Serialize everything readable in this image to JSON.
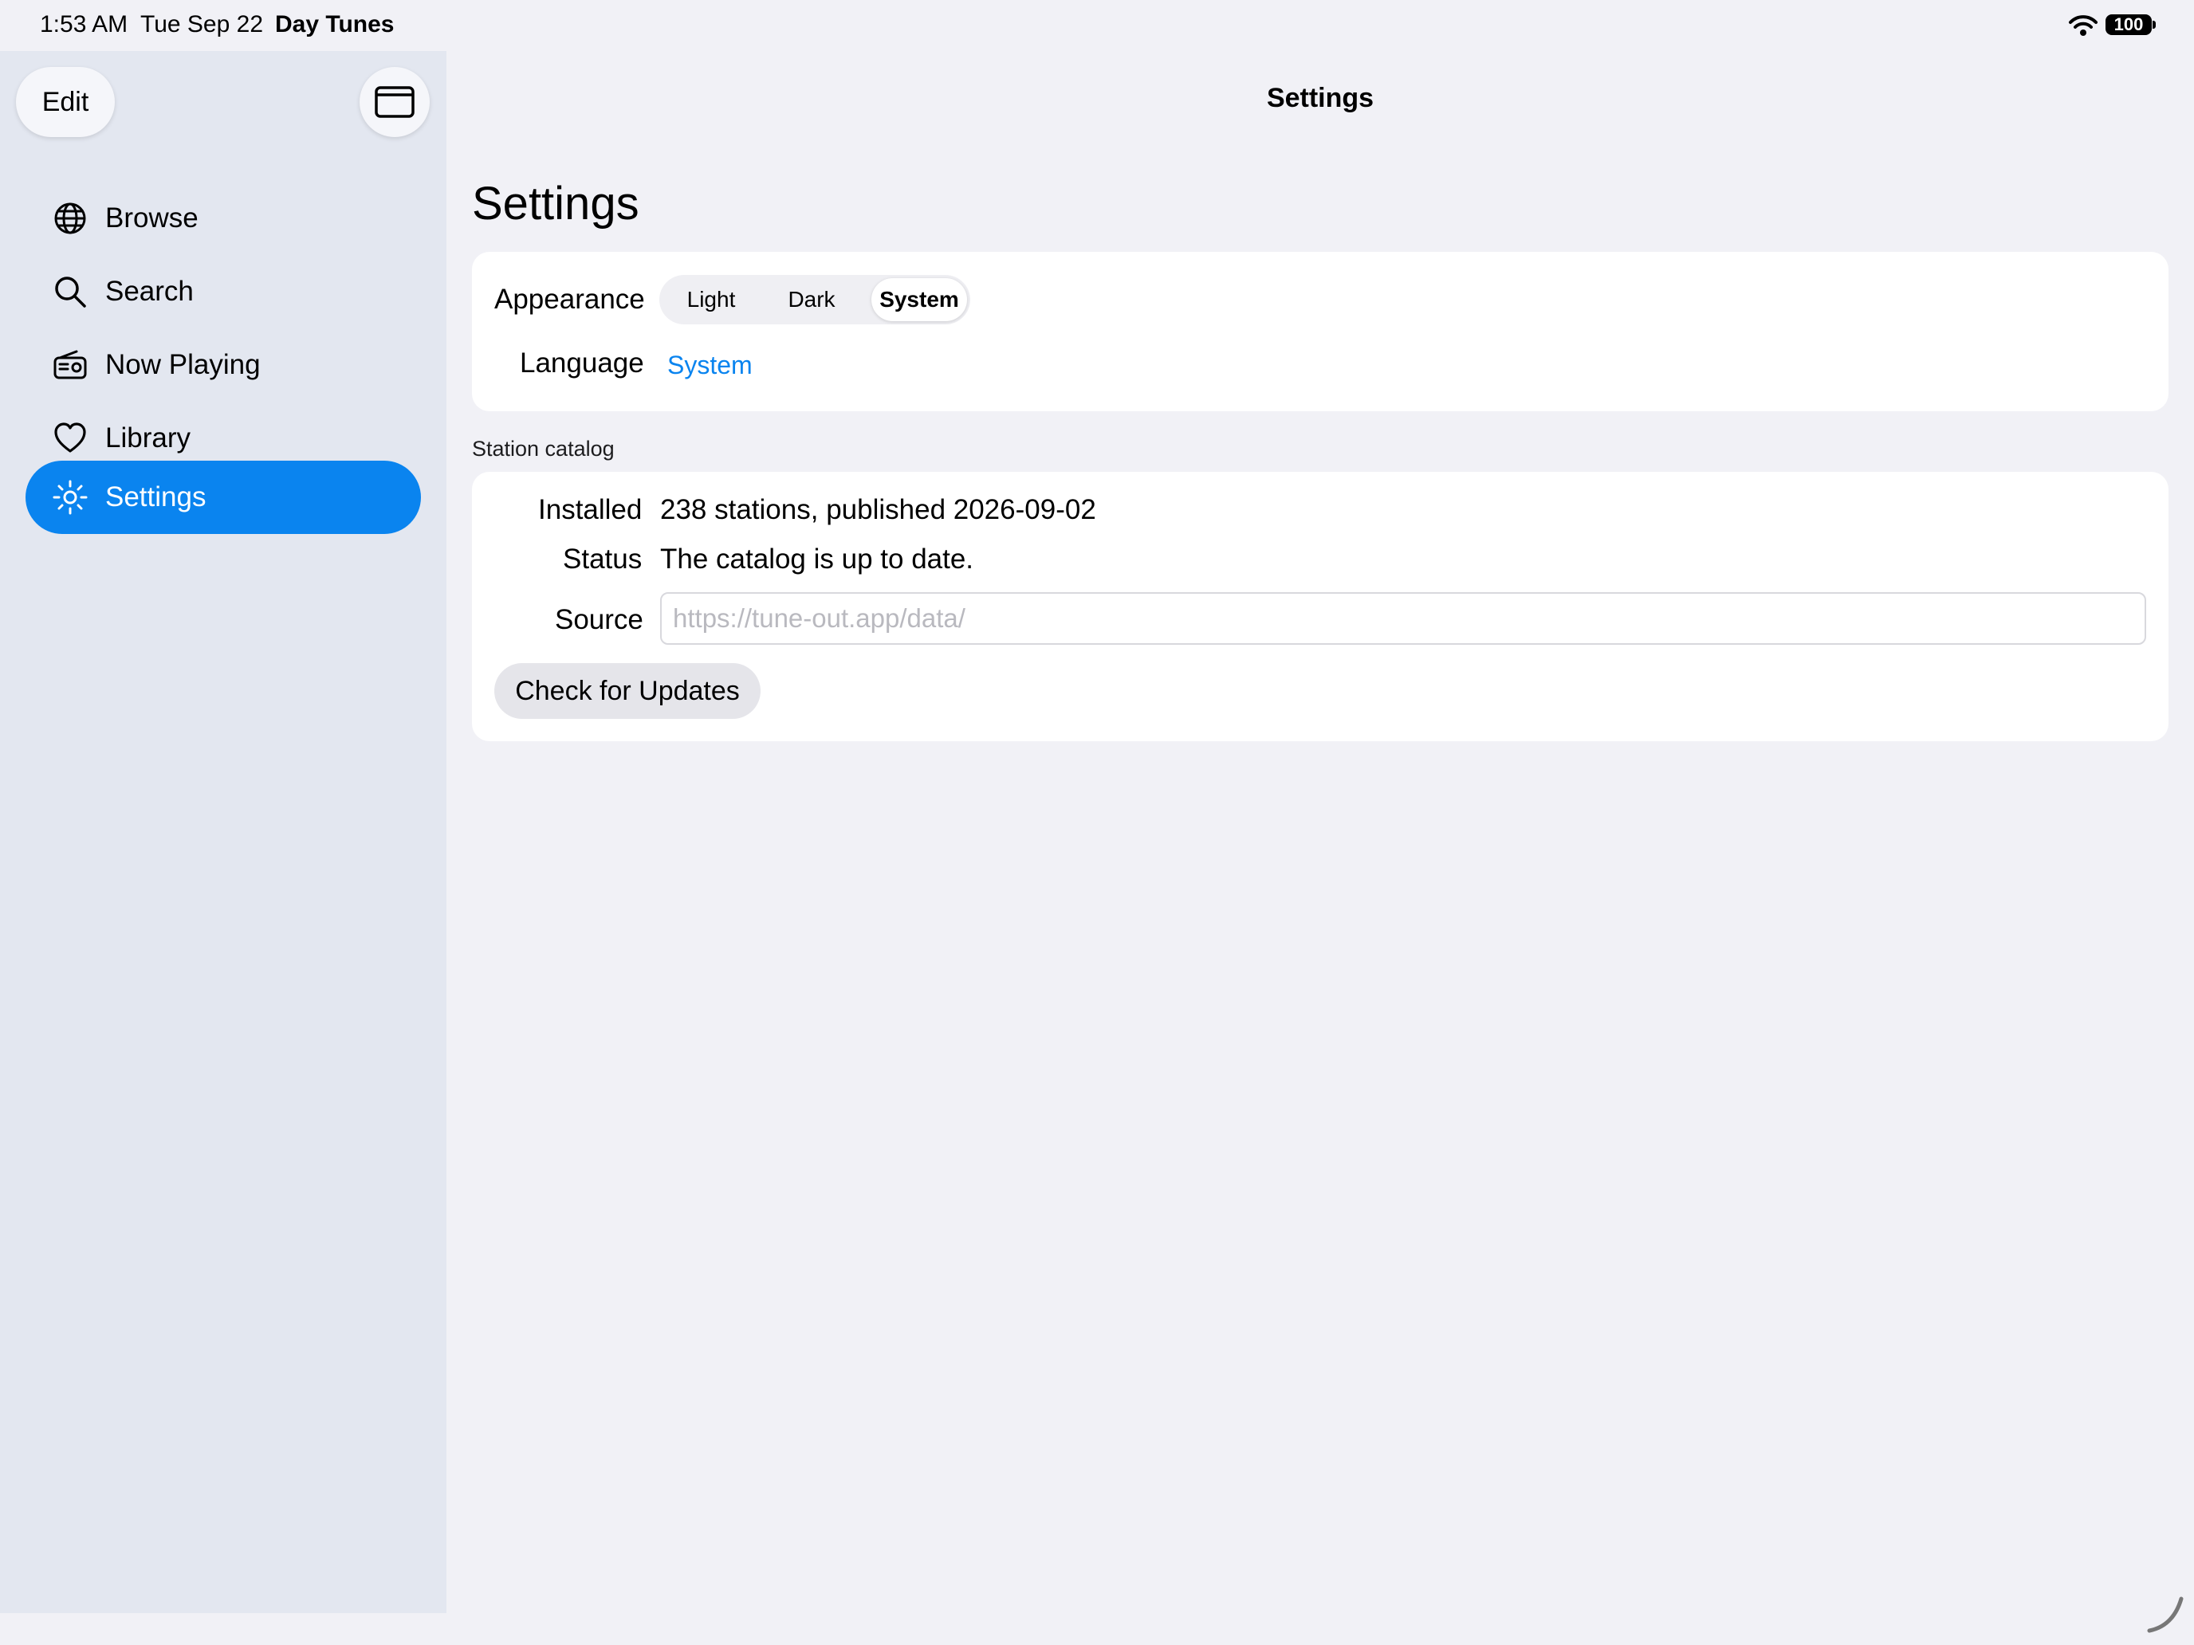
{
  "status_bar": {
    "time": "1:53 AM",
    "date": "Tue Sep 22",
    "app_name": "Day Tunes",
    "battery": "100",
    "wifi_icon": "wifi-icon"
  },
  "sidebar": {
    "edit_label": "Edit",
    "toggle_icon": "sidebar-toggle-icon",
    "items": [
      {
        "label": "Browse",
        "icon": "globe-icon",
        "active": false
      },
      {
        "label": "Search",
        "icon": "magnifier-icon",
        "active": false
      },
      {
        "label": "Now Playing",
        "icon": "radio-icon",
        "active": false
      },
      {
        "label": "Library",
        "icon": "heart-icon",
        "active": false
      },
      {
        "label": "Settings",
        "icon": "sun-gear-icon",
        "active": true
      }
    ],
    "active_color": "#0a84ef"
  },
  "main": {
    "nav_title": "Settings",
    "page_title": "Settings",
    "appearance": {
      "label": "Appearance",
      "options": [
        "Light",
        "Dark",
        "System"
      ],
      "selected": "System"
    },
    "language": {
      "label": "Language",
      "value": "System"
    },
    "catalog": {
      "section_title": "Station catalog",
      "installed_label": "Installed",
      "installed_value": "238 stations, published 2026-09-02",
      "status_label": "Status",
      "status_value": "The catalog is up to date.",
      "source_label": "Source",
      "source_value": "",
      "source_placeholder": "https://tune-out.app/data/",
      "update_button": "Check for Updates"
    }
  },
  "colors": {
    "accent": "#0a84ef",
    "background": "#f1f1f6",
    "sidebar": "#e3e7f0"
  }
}
